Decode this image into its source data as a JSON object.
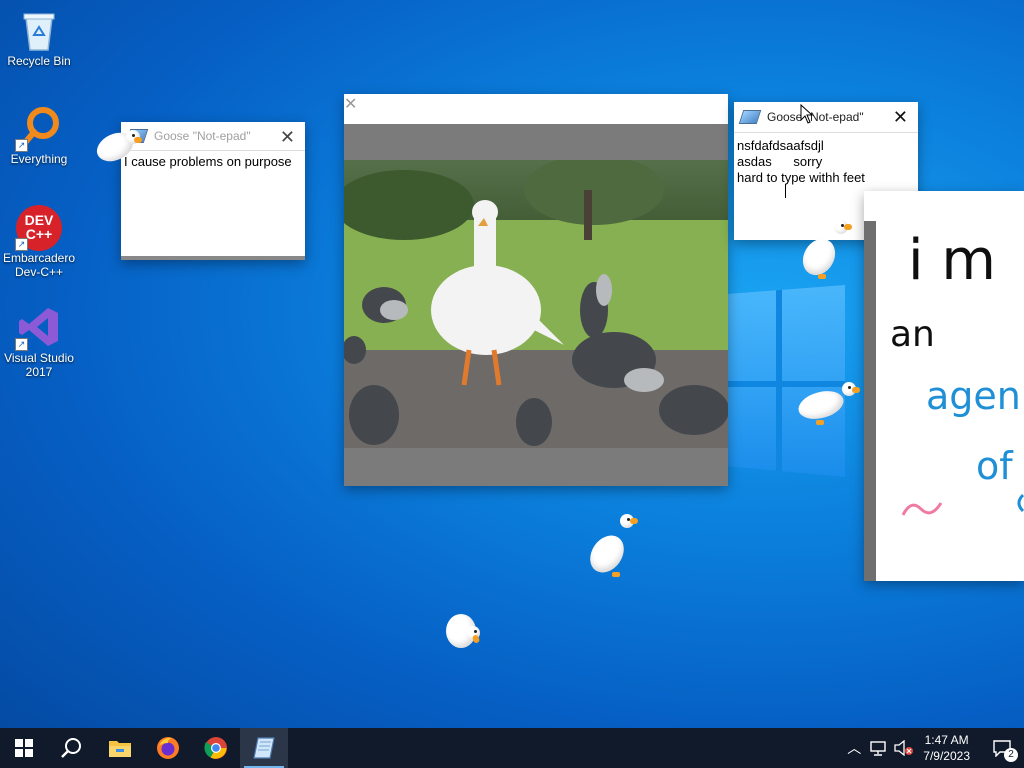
{
  "desktop": {
    "icons": [
      {
        "label_line1": "Recycle Bin",
        "label_line2": "",
        "icon": "recycle-bin-icon"
      },
      {
        "label_line1": "Everything",
        "label_line2": "",
        "icon": "everything-search-icon"
      },
      {
        "label_line1": "Embarcadero",
        "label_line2": "Dev-C++",
        "icon": "devcpp-icon",
        "badge_line1": "DEV",
        "badge_line2": "C++"
      },
      {
        "label_line1": "Visual Studio",
        "label_line2": "2017",
        "icon": "visual-studio-icon"
      }
    ]
  },
  "notepad1": {
    "title": "Goose \"Not-epad\"",
    "text": "I cause problems on purpose"
  },
  "notepad2": {
    "title": "Goose \"Not-epad\"",
    "text": "nsfdafdsaafsdjl\nasdas      sorry\nhard to type withh feet"
  },
  "drawing": {
    "line1": "i m",
    "line2": "an",
    "line3": "agen",
    "line4": "of",
    "ink_color": "#0f0f0f",
    "blue_ink": "#1f8fd6",
    "pink_ink": "#f07aa0"
  },
  "taskbar": {
    "apps": [
      {
        "name": "start",
        "icon": "windows-logo-icon"
      },
      {
        "name": "search",
        "icon": "search-icon"
      },
      {
        "name": "file-explorer",
        "icon": "folder-icon"
      },
      {
        "name": "firefox",
        "icon": "firefox-icon"
      },
      {
        "name": "chrome",
        "icon": "chrome-icon"
      },
      {
        "name": "notepad",
        "icon": "notepad-icon",
        "active": true
      }
    ],
    "time": "1:47 AM",
    "date": "7/9/2023",
    "notification_count": "2"
  },
  "colors": {
    "taskbar_bg": "#101a2a",
    "goose_beak": "#f6a023"
  }
}
